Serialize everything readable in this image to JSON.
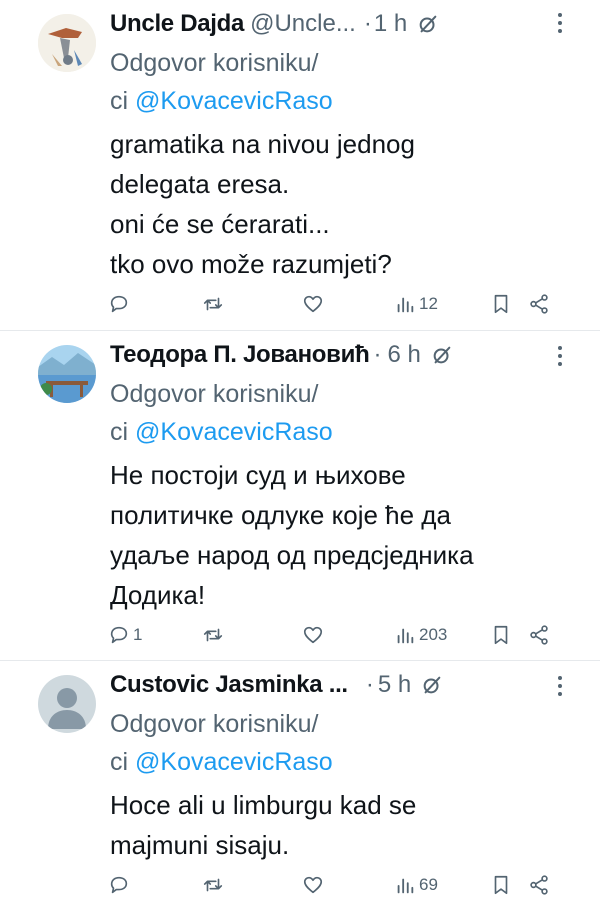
{
  "tweets": [
    {
      "name": "Uncle Dajda",
      "handle": "@Uncle...",
      "separator": "·",
      "time": "1 h",
      "reply_prefix": "Odgovor korisniku/",
      "reply_prefix2": "ci",
      "mention": "@KovacevicRaso",
      "body_lines": [
        "gramatika na nivou jednog",
        "delegata eresa.",
        "oni će se ćerarati...",
        "tko ovo može razumjeti?"
      ],
      "replies": "",
      "retweets": "",
      "likes": "",
      "views": "12"
    },
    {
      "name": "Теодора П. Јовановић",
      "handle": "",
      "separator": "·",
      "time": "6 h",
      "reply_prefix": "Odgovor korisniku/",
      "reply_prefix2": "ci",
      "mention": "@KovacevicRaso",
      "body_lines": [
        "Не постоји суд и њихове",
        "политичке одлуке које ће да",
        "удаље народ од предсједника",
        "Додика!"
      ],
      "replies": "1",
      "retweets": "",
      "likes": "",
      "views": "203"
    },
    {
      "name": "Custovic Jasminka ...",
      "handle": "",
      "separator": "·",
      "time": "5 h",
      "reply_prefix": "Odgovor korisniku/",
      "reply_prefix2": "ci",
      "mention": "@KovacevicRaso",
      "body_lines": [
        "Hoce ali u limburgu kad se",
        "majmuni sisaju."
      ],
      "replies": "",
      "retweets": "",
      "likes": "",
      "views": "69"
    }
  ],
  "icons": {
    "reply": "reply-icon",
    "retweet": "retweet-icon",
    "like": "heart-icon",
    "views": "views-icon",
    "bookmark": "bookmark-icon",
    "share": "share-icon",
    "grok": "grok-icon",
    "more": "more-icon"
  },
  "colors": {
    "text": "#0f1419",
    "secondary": "#536471",
    "link": "#1d9bf0",
    "divider": "#e6e9ec"
  }
}
